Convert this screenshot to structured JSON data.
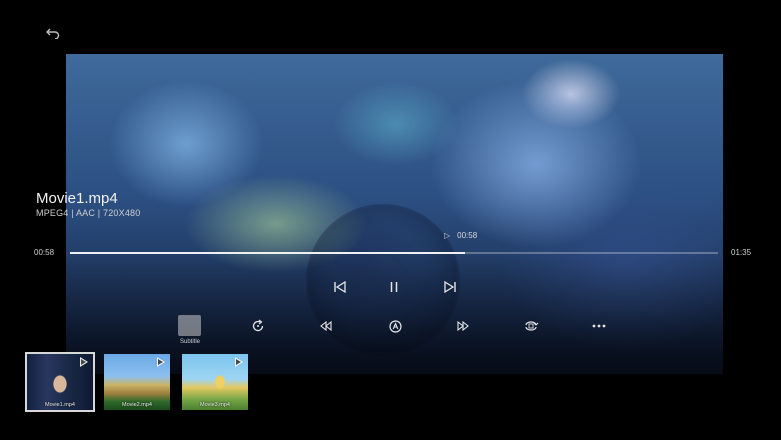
{
  "video": {
    "title": "Movie1.mp4",
    "meta": "MPEG4 | AAC | 720X480",
    "current_time": "00:58",
    "total_time": "01:35",
    "hover_time": "00:58",
    "progress": 0.61
  },
  "controls": {
    "subtitle_label": "Subtitle",
    "icons": [
      "back-icon",
      "previous-icon",
      "pause-icon",
      "next-icon",
      "repeat-icon",
      "rewind-icon",
      "a-b-repeat-icon",
      "fast-forward-icon",
      "rotate-icon",
      "more-icon"
    ]
  },
  "playlist": [
    {
      "name": "Movie1.mp4",
      "active": true
    },
    {
      "name": "Movie2.mp4",
      "active": false
    },
    {
      "name": "Movie3.mp4",
      "active": false
    }
  ]
}
